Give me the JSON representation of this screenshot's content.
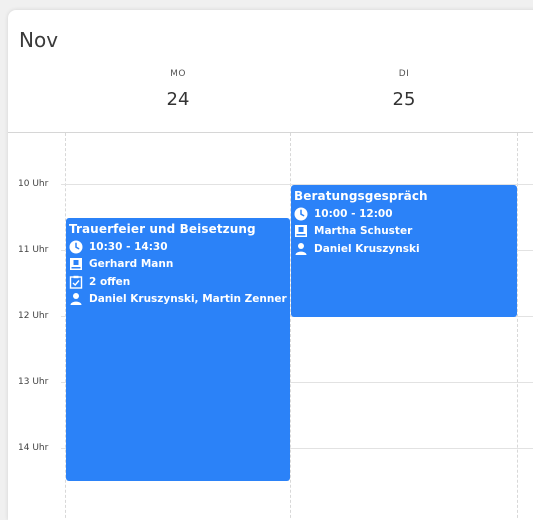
{
  "calendar": {
    "month": "Nov",
    "days": [
      {
        "dow": "MO",
        "date": "24"
      },
      {
        "dow": "DI",
        "date": "25"
      }
    ],
    "hours": [
      "10 Uhr",
      "11 Uhr",
      "12 Uhr",
      "13 Uhr",
      "14 Uhr"
    ]
  },
  "events": [
    {
      "title": "Trauerfeier und Beisetzung",
      "time": "10:30 - 14:30",
      "contact": "Gerhard Mann",
      "tasks": "2 offen",
      "staff": "Daniel Kruszynski, Martin Zenner"
    },
    {
      "title": "Beratungsgespräch",
      "time": "10:00 - 12:00",
      "contact": "Martha Schuster",
      "staff": "Daniel Kruszynski"
    }
  ],
  "colors": {
    "event": "#2b82f8",
    "text": "#ffffff"
  },
  "icons": [
    "clock-icon",
    "contact-card-icon",
    "checklist-icon",
    "person-icon"
  ]
}
